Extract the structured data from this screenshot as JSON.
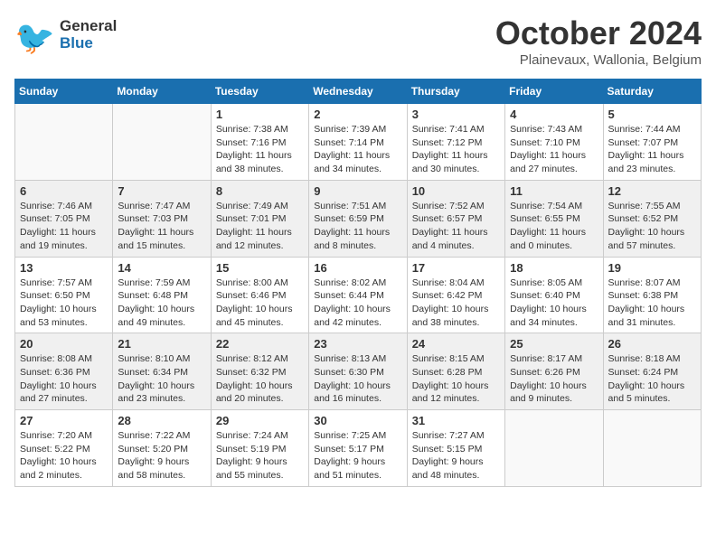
{
  "logo": {
    "general": "General",
    "blue": "Blue"
  },
  "header": {
    "month": "October 2024",
    "location": "Plainevaux, Wallonia, Belgium"
  },
  "weekdays": [
    "Sunday",
    "Monday",
    "Tuesday",
    "Wednesday",
    "Thursday",
    "Friday",
    "Saturday"
  ],
  "weeks": [
    [
      {
        "num": "",
        "info": "",
        "empty": true
      },
      {
        "num": "",
        "info": "",
        "empty": true
      },
      {
        "num": "1",
        "info": "Sunrise: 7:38 AM\nSunset: 7:16 PM\nDaylight: 11 hours and 38 minutes."
      },
      {
        "num": "2",
        "info": "Sunrise: 7:39 AM\nSunset: 7:14 PM\nDaylight: 11 hours and 34 minutes."
      },
      {
        "num": "3",
        "info": "Sunrise: 7:41 AM\nSunset: 7:12 PM\nDaylight: 11 hours and 30 minutes."
      },
      {
        "num": "4",
        "info": "Sunrise: 7:43 AM\nSunset: 7:10 PM\nDaylight: 11 hours and 27 minutes."
      },
      {
        "num": "5",
        "info": "Sunrise: 7:44 AM\nSunset: 7:07 PM\nDaylight: 11 hours and 23 minutes."
      }
    ],
    [
      {
        "num": "6",
        "info": "Sunrise: 7:46 AM\nSunset: 7:05 PM\nDaylight: 11 hours and 19 minutes."
      },
      {
        "num": "7",
        "info": "Sunrise: 7:47 AM\nSunset: 7:03 PM\nDaylight: 11 hours and 15 minutes."
      },
      {
        "num": "8",
        "info": "Sunrise: 7:49 AM\nSunset: 7:01 PM\nDaylight: 11 hours and 12 minutes."
      },
      {
        "num": "9",
        "info": "Sunrise: 7:51 AM\nSunset: 6:59 PM\nDaylight: 11 hours and 8 minutes."
      },
      {
        "num": "10",
        "info": "Sunrise: 7:52 AM\nSunset: 6:57 PM\nDaylight: 11 hours and 4 minutes."
      },
      {
        "num": "11",
        "info": "Sunrise: 7:54 AM\nSunset: 6:55 PM\nDaylight: 11 hours and 0 minutes."
      },
      {
        "num": "12",
        "info": "Sunrise: 7:55 AM\nSunset: 6:52 PM\nDaylight: 10 hours and 57 minutes."
      }
    ],
    [
      {
        "num": "13",
        "info": "Sunrise: 7:57 AM\nSunset: 6:50 PM\nDaylight: 10 hours and 53 minutes."
      },
      {
        "num": "14",
        "info": "Sunrise: 7:59 AM\nSunset: 6:48 PM\nDaylight: 10 hours and 49 minutes."
      },
      {
        "num": "15",
        "info": "Sunrise: 8:00 AM\nSunset: 6:46 PM\nDaylight: 10 hours and 45 minutes."
      },
      {
        "num": "16",
        "info": "Sunrise: 8:02 AM\nSunset: 6:44 PM\nDaylight: 10 hours and 42 minutes."
      },
      {
        "num": "17",
        "info": "Sunrise: 8:04 AM\nSunset: 6:42 PM\nDaylight: 10 hours and 38 minutes."
      },
      {
        "num": "18",
        "info": "Sunrise: 8:05 AM\nSunset: 6:40 PM\nDaylight: 10 hours and 34 minutes."
      },
      {
        "num": "19",
        "info": "Sunrise: 8:07 AM\nSunset: 6:38 PM\nDaylight: 10 hours and 31 minutes."
      }
    ],
    [
      {
        "num": "20",
        "info": "Sunrise: 8:08 AM\nSunset: 6:36 PM\nDaylight: 10 hours and 27 minutes."
      },
      {
        "num": "21",
        "info": "Sunrise: 8:10 AM\nSunset: 6:34 PM\nDaylight: 10 hours and 23 minutes."
      },
      {
        "num": "22",
        "info": "Sunrise: 8:12 AM\nSunset: 6:32 PM\nDaylight: 10 hours and 20 minutes."
      },
      {
        "num": "23",
        "info": "Sunrise: 8:13 AM\nSunset: 6:30 PM\nDaylight: 10 hours and 16 minutes."
      },
      {
        "num": "24",
        "info": "Sunrise: 8:15 AM\nSunset: 6:28 PM\nDaylight: 10 hours and 12 minutes."
      },
      {
        "num": "25",
        "info": "Sunrise: 8:17 AM\nSunset: 6:26 PM\nDaylight: 10 hours and 9 minutes."
      },
      {
        "num": "26",
        "info": "Sunrise: 8:18 AM\nSunset: 6:24 PM\nDaylight: 10 hours and 5 minutes."
      }
    ],
    [
      {
        "num": "27",
        "info": "Sunrise: 7:20 AM\nSunset: 5:22 PM\nDaylight: 10 hours and 2 minutes."
      },
      {
        "num": "28",
        "info": "Sunrise: 7:22 AM\nSunset: 5:20 PM\nDaylight: 9 hours and 58 minutes."
      },
      {
        "num": "29",
        "info": "Sunrise: 7:24 AM\nSunset: 5:19 PM\nDaylight: 9 hours and 55 minutes."
      },
      {
        "num": "30",
        "info": "Sunrise: 7:25 AM\nSunset: 5:17 PM\nDaylight: 9 hours and 51 minutes."
      },
      {
        "num": "31",
        "info": "Sunrise: 7:27 AM\nSunset: 5:15 PM\nDaylight: 9 hours and 48 minutes."
      },
      {
        "num": "",
        "info": "",
        "empty": true
      },
      {
        "num": "",
        "info": "",
        "empty": true
      }
    ]
  ]
}
